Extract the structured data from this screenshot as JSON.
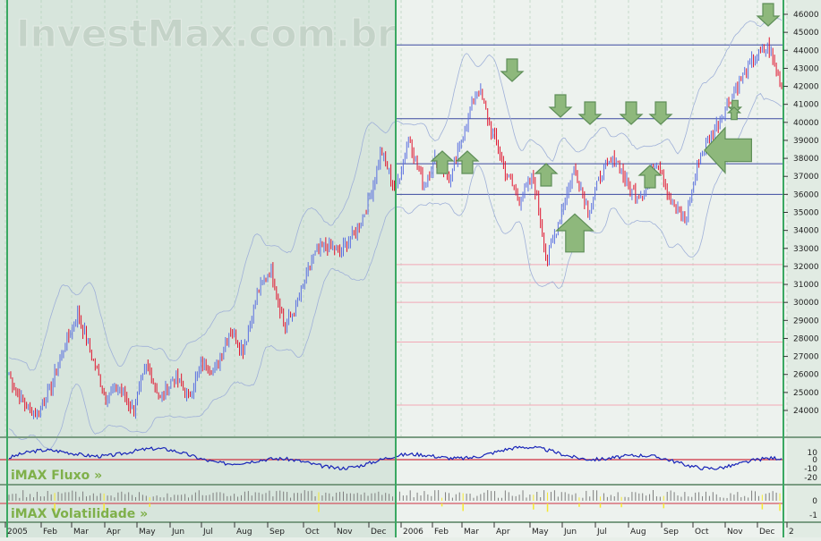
{
  "watermark": "InvestMax.com.br",
  "panels": {
    "fluxo_label": "iMAX Fluxo »",
    "volat_label": "iMAX Volatilidade »"
  },
  "chart_data": {
    "type": "candlestick",
    "y_axis": {
      "ticks": [
        24000,
        25000,
        26000,
        27000,
        28000,
        29000,
        30000,
        31000,
        32000,
        33000,
        34000,
        35000,
        36000,
        37000,
        38000,
        39000,
        40000,
        41000,
        42000,
        43000,
        44000,
        45000,
        46000
      ],
      "range": [
        23400,
        46400
      ],
      "side": "right"
    },
    "x_axis": {
      "labels": [
        "2005",
        "Feb",
        "Mar",
        "Apr",
        "May",
        "Jun",
        "Jul",
        "Aug",
        "Sep",
        "Oct",
        "Nov",
        "Dec",
        "2006",
        "Feb",
        "Mar",
        "Apr",
        "May",
        "Jun",
        "Jul",
        "Aug",
        "Sep",
        "Oct",
        "Nov",
        "Dec",
        "2"
      ]
    },
    "series": [
      {
        "type": "candles",
        "close_path": [
          [
            0,
            26000
          ],
          [
            1,
            24400
          ],
          [
            2,
            23800
          ],
          [
            3,
            25200
          ],
          [
            4,
            27500
          ],
          [
            5,
            29400
          ],
          [
            6,
            27000
          ],
          [
            7,
            24800
          ],
          [
            8,
            25300
          ],
          [
            9,
            24000
          ],
          [
            10,
            26500
          ],
          [
            11,
            24600
          ],
          [
            12,
            25900
          ],
          [
            13,
            24700
          ],
          [
            14,
            26700
          ],
          [
            15,
            26200
          ],
          [
            16,
            28500
          ],
          [
            17,
            27400
          ],
          [
            18,
            30500
          ],
          [
            19,
            31900
          ],
          [
            20,
            28600
          ],
          [
            21,
            30100
          ],
          [
            22,
            32500
          ],
          [
            23,
            33200
          ],
          [
            24,
            32800
          ],
          [
            25,
            33800
          ],
          [
            26,
            35400
          ],
          [
            27,
            38400
          ],
          [
            28,
            36200
          ],
          [
            29,
            39200
          ],
          [
            30,
            36500
          ],
          [
            31,
            38100
          ],
          [
            32,
            36700
          ],
          [
            33,
            39600
          ],
          [
            34,
            42000
          ],
          [
            35,
            39500
          ],
          [
            36,
            37200
          ],
          [
            37,
            35700
          ],
          [
            38,
            36900
          ],
          [
            39,
            32300
          ],
          [
            40,
            35000
          ],
          [
            41,
            37500
          ],
          [
            42,
            35100
          ],
          [
            43,
            37300
          ],
          [
            44,
            38000
          ],
          [
            45,
            36200
          ],
          [
            46,
            36000
          ],
          [
            47,
            38000
          ],
          [
            48,
            35600
          ],
          [
            49,
            34400
          ],
          [
            50,
            38000
          ],
          [
            51,
            39400
          ],
          [
            52,
            41000
          ],
          [
            53,
            42300
          ],
          [
            54,
            43500
          ],
          [
            55,
            44200
          ],
          [
            56,
            42000
          ]
        ]
      },
      {
        "type": "reference_lines",
        "values": [
          44300,
          40200,
          37700,
          36000
        ]
      },
      {
        "type": "reference_lines_pink",
        "values": [
          32100,
          31100,
          30000,
          27800,
          24300
        ]
      }
    ],
    "annotations": {
      "arrows": [
        {
          "dir": "down"
        },
        {
          "dir": "down"
        },
        {
          "dir": "down"
        },
        {
          "dir": "down"
        },
        {
          "dir": "down"
        },
        {
          "dir": "down"
        },
        {
          "dir": "down"
        },
        {
          "dir": "up"
        },
        {
          "dir": "up"
        },
        {
          "dir": "up"
        },
        {
          "dir": "up"
        },
        {
          "dir": "up"
        },
        {
          "dir": "up"
        },
        {
          "dir": "left"
        }
      ]
    },
    "fluxo": {
      "ticks": [
        10,
        0,
        -10,
        -20
      ]
    },
    "volatilidade": {
      "ticks": [
        0,
        -1
      ]
    }
  },
  "colors": {
    "background_history": "#d7e5dc",
    "background_recent": "#edf2ee",
    "grid": "#b4d0bb",
    "up_candle": "#5a6fe0",
    "down_candle": "#e0142e",
    "band": "#9fb0d8",
    "hline": "#3c4aa0",
    "pink_line": "#f2a8b6",
    "divider": "#3aa862",
    "arrow_fill": "#8eb87c",
    "arrow_stroke": "#5f8f58",
    "flux_line": "#1723b8",
    "zero_line": "#d03040",
    "volume_bar": "#7f7f7f",
    "volume_hi": "#f6e830"
  }
}
